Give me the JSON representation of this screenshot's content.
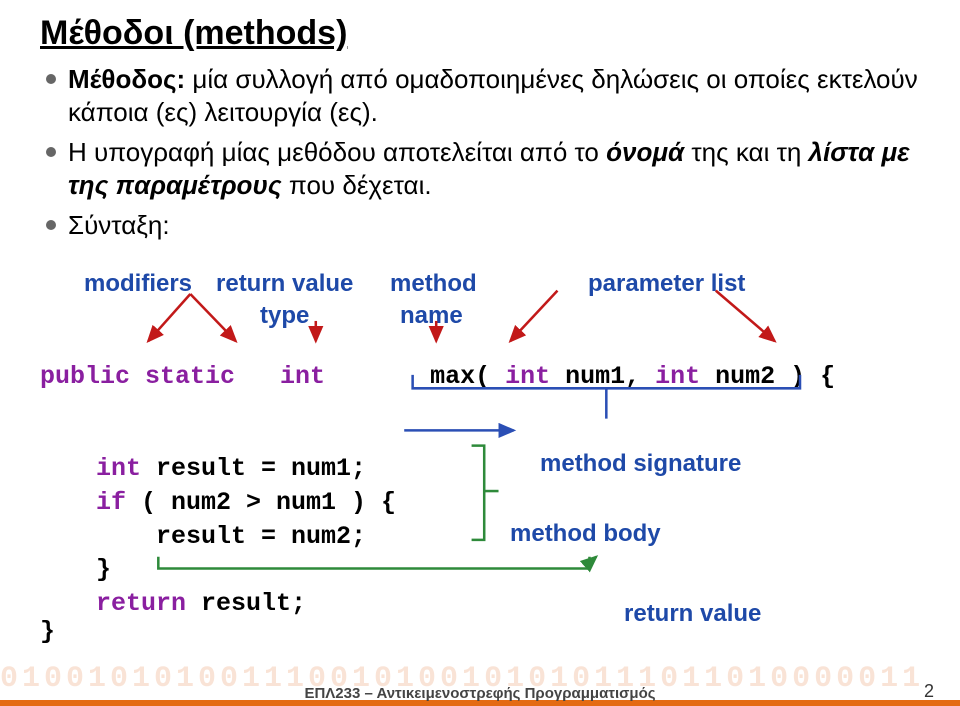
{
  "title": "Μέθοδοι (methods)",
  "bullets": {
    "b1_bold": "Μέθοδος: ",
    "b1_rest": "μία συλλογή από ομαδοποιημένες δηλώσεις οι οποίες εκτελούν κάποια (ες) λειτουργία (ες).",
    "b2_a": "Η υπογραφή μίας μεθόδου αποτελείται από το ",
    "b2_it1": "όνομά ",
    "b2_b": "της και τη ",
    "b2_it2": "λίστα με της παραμέτρους ",
    "b2_c": "που δέχεται.",
    "b3": "Σύνταξη:"
  },
  "labels": {
    "modifiers": "modifiers",
    "return_value": "return value",
    "type": "type",
    "method": "method",
    "name": "name",
    "parameter_list": "parameter list",
    "method_signature": "method signature",
    "method_body": "method body",
    "return_value_bottom": "return value"
  },
  "code": {
    "sig_public_static": "public static",
    "sig_int": "   int",
    "sig_max": "       max(",
    "sig_int2": " int",
    "sig_num1": " num1,",
    "sig_int3": " int",
    "sig_num2": " num2 ) {",
    "line1_int": "int",
    "line1_rest": " result = num1;",
    "line2_if": "if",
    "line2_rest": " ( num2 > num1 ) {",
    "line3": "    result = num2;",
    "line4": "}",
    "line5_ret": "return",
    "line5_rest": " result;",
    "close": "}"
  },
  "footer": {
    "binary": "010010101001110010100101010111011010000011",
    "course": "ΕΠΛ233 – Αντικειμενοστρεφής Προγραμματισμός",
    "page": "2"
  },
  "colors": {
    "label_blue": "#1e49a8",
    "arrow_red": "#c21919",
    "arrow_blue": "#2b4fb5",
    "bracket_green": "#2e8a3a"
  }
}
